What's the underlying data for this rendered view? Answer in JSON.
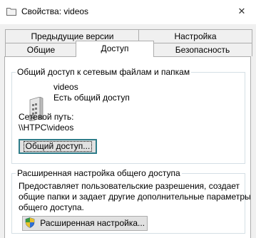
{
  "window": {
    "title": "Свойства: videos",
    "close_glyph": "✕",
    "icon": "folder-icon"
  },
  "tabs": {
    "row_top": [
      "Предыдущие версии",
      "Настройка"
    ],
    "row_bottom": [
      "Общие",
      "Доступ",
      "Безопасность"
    ],
    "active": "Доступ"
  },
  "network_sharing": {
    "legend": "Общий доступ к сетевым файлам и папкам",
    "folder_name": "videos",
    "share_status": "Есть общий доступ",
    "network_path_label": "Сетевой путь:",
    "network_path": "\\\\HTPC\\videos",
    "share_button": "Общий доступ..."
  },
  "advanced_sharing": {
    "legend": "Расширенная настройка общего доступа",
    "description": [
      "Предоставляет пользовательские разрешения, создает",
      "общие папки и задает другие дополнительные параметры",
      "общего доступа."
    ],
    "button": "Расширенная настройка...",
    "button_icon": "uac-shield-icon"
  },
  "colors": {
    "accent_border": "#2f7d8a",
    "group_border": "#d5dfe5",
    "tab_border": "#adadad"
  }
}
